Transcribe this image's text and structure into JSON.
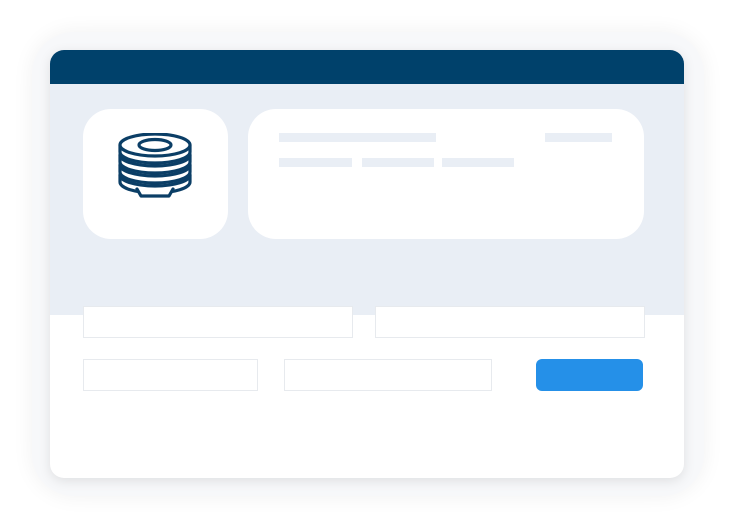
{
  "colors": {
    "titlebar": "#00416b",
    "band": "#e9eef5",
    "accent": "#2590e8",
    "icon_stroke": "#0b3e66"
  },
  "header": {
    "icon_name": "coin-stack-icon"
  },
  "form": {
    "submit_label": ""
  }
}
